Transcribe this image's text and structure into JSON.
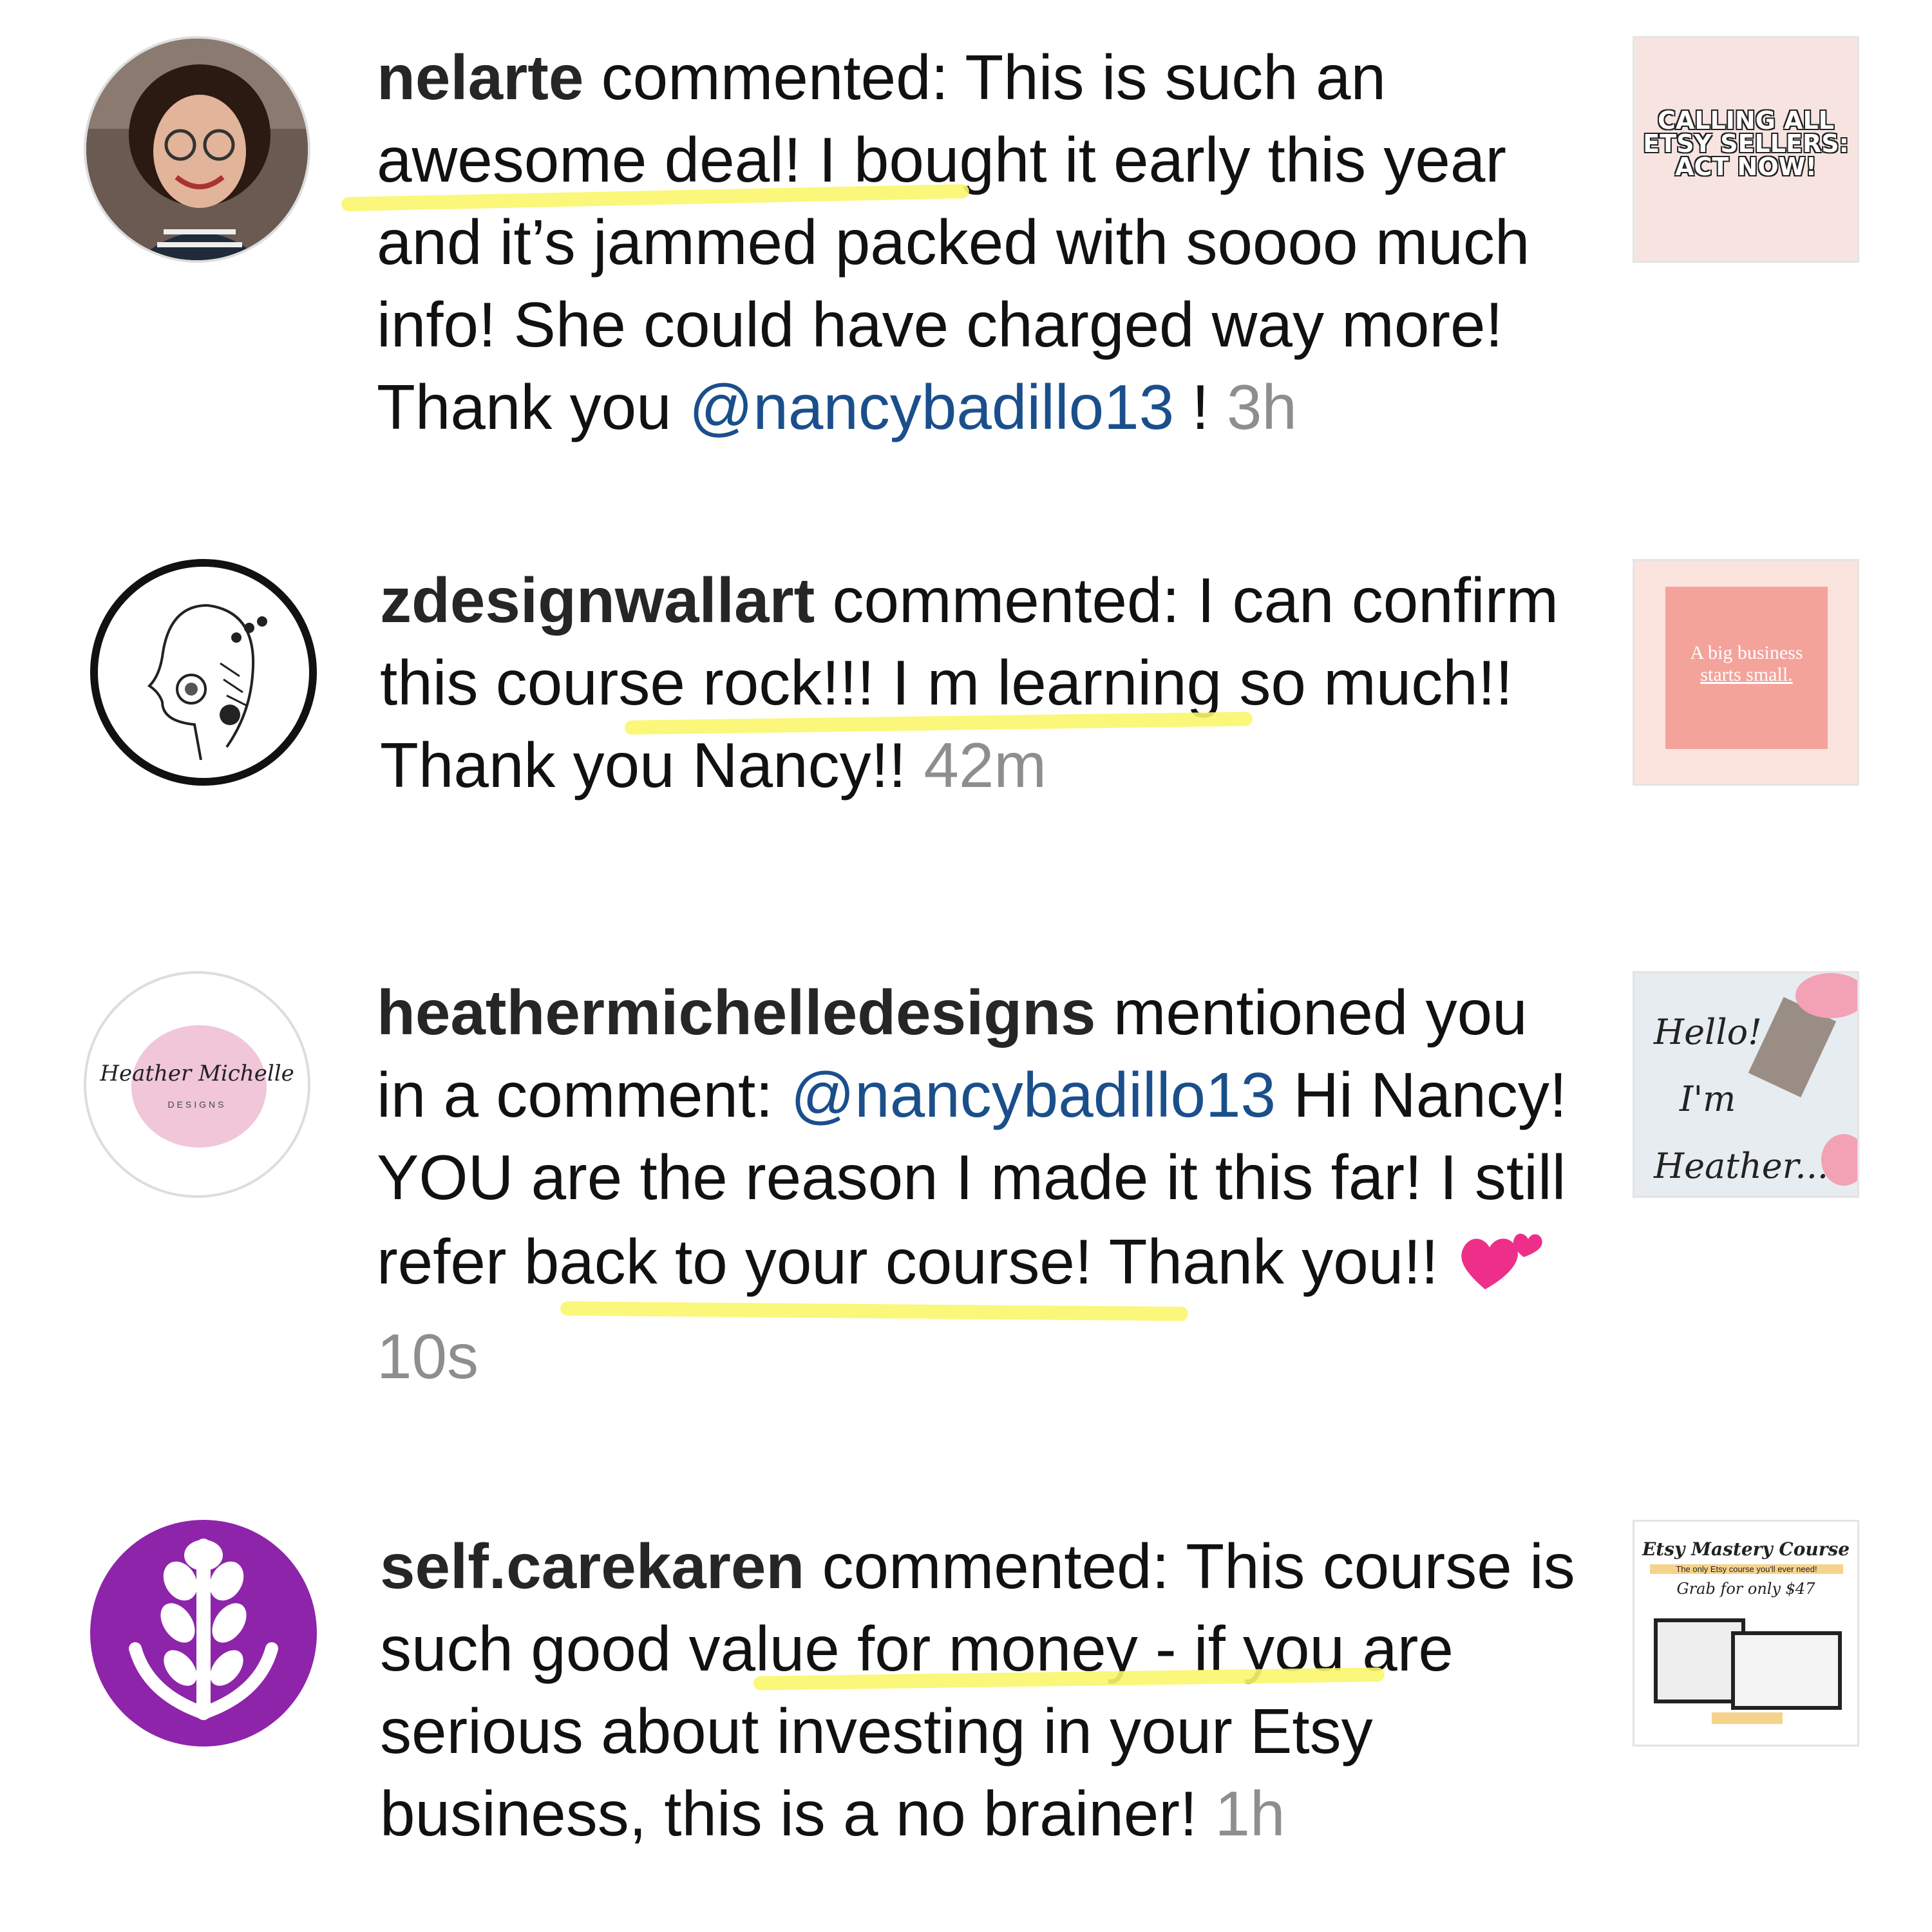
{
  "notifications": [
    {
      "username": "nelarte",
      "action": "commented:",
      "text_before": "This is such",
      "highlight": "an awesome deal!",
      "text_after": "I bought it early this year and it’s jammed packed with soooo much info! She could have charged way more! Thank you",
      "mention": "@nancybadillo13",
      "text_end": "!",
      "time": "3h",
      "thumb_lines": [
        "CALLING ALL",
        "ETSY SELLERS:",
        "ACT NOW!"
      ],
      "avatar_icon": "woman-portrait"
    },
    {
      "username": "zdesignwallart",
      "action": "commented:",
      "text_before": "I can confirm",
      "highlight": "this course rock!!!",
      "text_after": "I m learning so much!! Thank you Nancy!!",
      "time": "42m",
      "thumb_lines": [
        "A big business",
        "starts small."
      ],
      "avatar_icon": "line-art-face"
    },
    {
      "username": "heathermichelledesigns",
      "action": "mentioned you in a comment:",
      "mention": "@nancybadillo13",
      "text_before": "Hi Nancy! YOU are the",
      "highlight": "reason I made it this far!",
      "text_after": "I still refer back to your course! Thank you!!",
      "time": "10s",
      "avatar_script": "Heather Michelle",
      "avatar_sub": "DESIGNS",
      "thumb_lines": [
        "Hello!",
        "I'm",
        "Heather..."
      ]
    },
    {
      "username": "self.carekaren",
      "action": "commented:",
      "text_before": "This course is",
      "highlight": "such good value for",
      "text_after": "money - if you are serious about investing in your Etsy business, this is a no brainer!",
      "time": "1h",
      "thumb_lines": [
        "Etsy Mastery Course",
        "The only Etsy course you'll ever need!",
        "Grab for only $47"
      ],
      "avatar_icon": "lavender-icon",
      "colors": {
        "avatar_bg": "#8e24aa"
      }
    }
  ],
  "colors": {
    "mention": "#1a4f8b",
    "time": "#8e8e8e",
    "highlight": "#fbf66b"
  }
}
